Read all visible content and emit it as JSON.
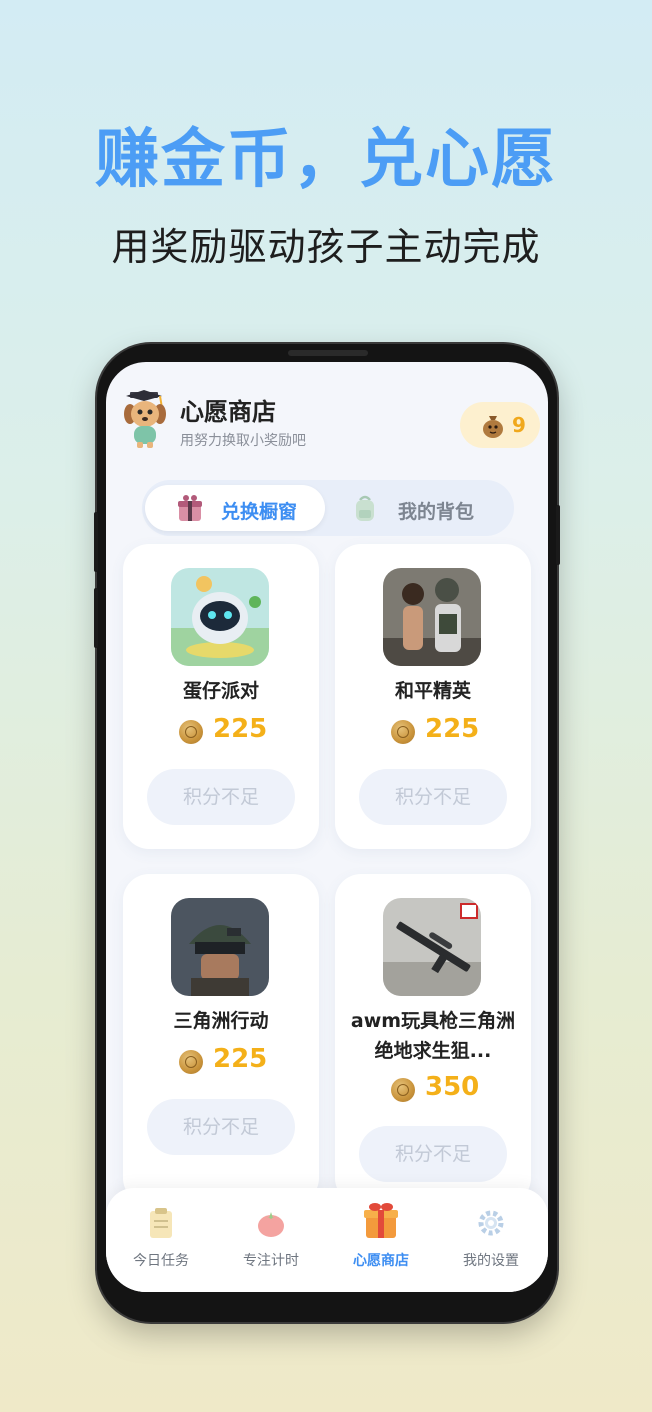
{
  "promo": {
    "headline": "赚金币，兑心愿",
    "subline": "用奖励驱动孩子主动完成"
  },
  "header": {
    "title": "心愿商店",
    "subtitle": "用努力换取小奖励吧",
    "coin_balance": "9"
  },
  "tabs": [
    {
      "label": "兑换橱窗",
      "icon": "gift-box-icon",
      "active": true
    },
    {
      "label": "我的背包",
      "icon": "backpack-icon",
      "active": false
    }
  ],
  "items": [
    {
      "name": "蛋仔派对",
      "price": "225",
      "button": "积分不足",
      "image": "robot-game-thumbnail"
    },
    {
      "name": "和平精英",
      "price": "225",
      "button": "积分不足",
      "image": "soldiers-game-thumbnail"
    },
    {
      "name": "三角洲行动",
      "price": "225",
      "button": "积分不足",
      "image": "soldier-helmet-thumbnail"
    },
    {
      "name": "awm玩具枪三角洲绝地求生狙...",
      "price": "350",
      "button": "积分不足",
      "image": "toy-rifle-thumbnail"
    }
  ],
  "nav": [
    {
      "label": "今日任务",
      "icon": "clipboard-icon",
      "active": false
    },
    {
      "label": "专注计时",
      "icon": "tomato-icon",
      "active": false
    },
    {
      "label": "心愿商店",
      "icon": "gift-box-icon",
      "active": true
    },
    {
      "label": "我的设置",
      "icon": "gear-icon",
      "active": false
    }
  ],
  "colors": {
    "accent": "#3d8ef2",
    "headline": "#4c9df5",
    "price": "#f4b019",
    "coin_pill_bg": "#fdf0cf"
  }
}
